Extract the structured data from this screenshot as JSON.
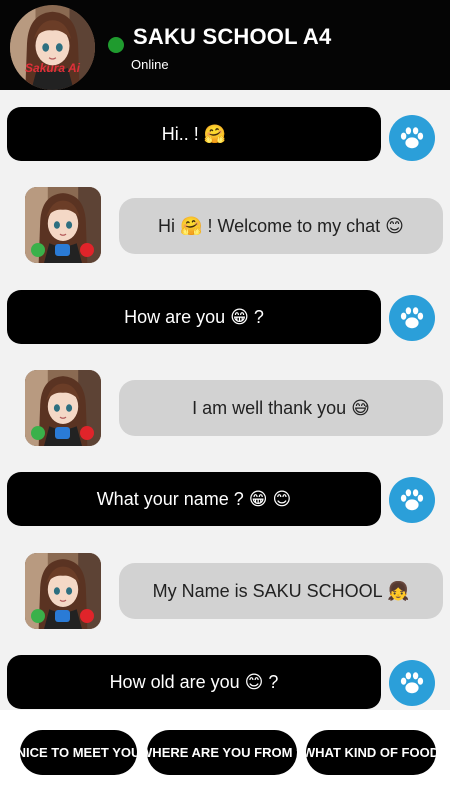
{
  "header": {
    "title": "SAKU SCHOOL A4",
    "status": "Online",
    "avatar_caption": "Sakura Ai",
    "status_color": "#1f9b2e"
  },
  "messages": [
    {
      "from": "user",
      "text": "Hi.. ! 🤗"
    },
    {
      "from": "bot",
      "text": "Hi 🤗 ! Welcome to my chat 😊"
    },
    {
      "from": "user",
      "text": "How are you 😁 ?"
    },
    {
      "from": "bot",
      "text": "I am well thank you 😅"
    },
    {
      "from": "user",
      "text": "What your name ? 😁 😊"
    },
    {
      "from": "bot",
      "text": "My Name is SAKU SCHOOL 👧"
    },
    {
      "from": "user",
      "text": "How old are you 😊 ?"
    }
  ],
  "icons": {
    "send_avatar": "paw-icon",
    "call_accept": "phone-icon",
    "video_call": "video-camera-icon",
    "call_decline": "hang-up-icon"
  },
  "quick_replies": [
    "NICE TO MEET YOU",
    "WHERE ARE YOU FROM ?",
    "WHAT KIND OF FOOD"
  ],
  "colors": {
    "header_bg": "#050505",
    "sent_bubble": "#000000",
    "received_bubble": "#d2d2d2",
    "paw_button": "#2b9fd9",
    "chat_bg": "#f2f2f2"
  }
}
